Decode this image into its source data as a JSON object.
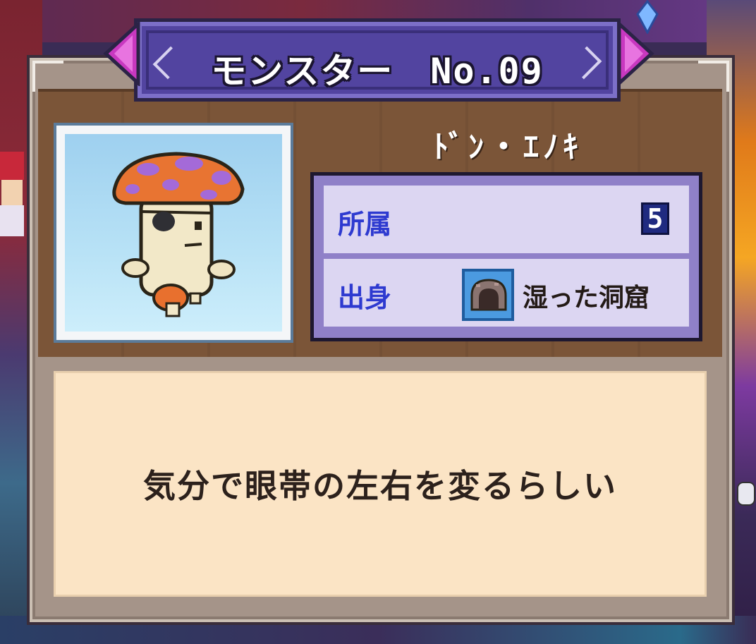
{
  "header": {
    "title": "モンスター　No.09",
    "prev_label": "◀",
    "next_label": "▶"
  },
  "monster": {
    "name": "ﾄﾞﾝ・ｴﾉｷ",
    "portrait_icon": "mushroom-monster-icon"
  },
  "info": {
    "affiliation_label": "所属",
    "affiliation_value": "5",
    "origin_label": "出身",
    "origin_icon": "cave-icon",
    "origin_value": "湿った洞窟"
  },
  "description": {
    "text": "気分で眼帯の左右を変るらしい"
  },
  "colors": {
    "banner": "#5244a0",
    "arrow": "#c030b8",
    "panel_wood": "#7b5538",
    "info_box": "#8f80c8",
    "label_blue": "#2e3ad0",
    "description_bg": "#fbe4c5"
  }
}
